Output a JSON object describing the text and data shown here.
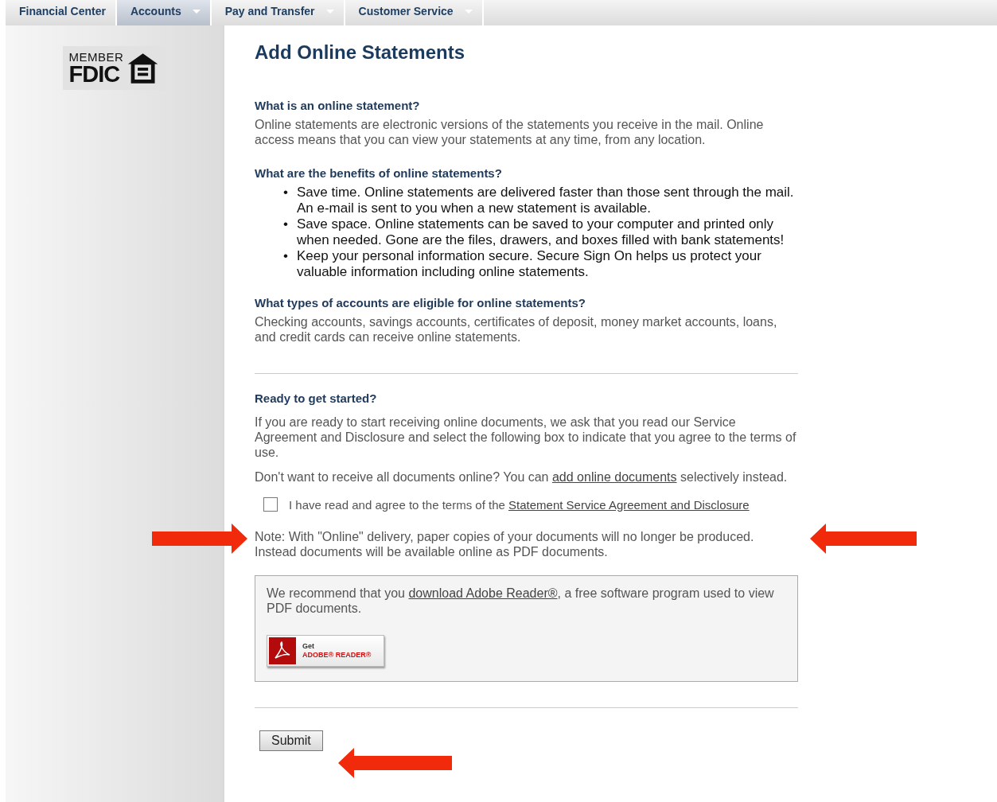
{
  "nav": {
    "tabs": [
      {
        "label": "Financial Center",
        "selected": false,
        "dropdown": false
      },
      {
        "label": "Accounts",
        "selected": true,
        "dropdown": true
      },
      {
        "label": "Pay and Transfer",
        "selected": false,
        "dropdown": true
      },
      {
        "label": "Customer Service",
        "selected": false,
        "dropdown": true
      }
    ]
  },
  "sidebar": {
    "logo": {
      "member": "MEMBER",
      "name": "FDIC"
    }
  },
  "title": "Add Online Statements",
  "sections": [
    {
      "heading": "What is an online statement?",
      "kind": "text",
      "text": "Online statements are electronic versions of the statements you receive in the mail. Online access means that you can view your statements at any time, from any location."
    },
    {
      "heading": "What are the benefits of online statements?",
      "kind": "bullets",
      "marker": "•",
      "items": [
        "Save time. Online statements are delivered faster than those sent through the mail. An e-mail is sent to you when a new statement is available.",
        "Save space. Online statements can be saved to your computer and printed only when needed. Gone are the files, drawers, and boxes filled with bank statements!",
        "Keep your personal information secure. Secure Sign On helps us protect your valuable information including online statements."
      ]
    },
    {
      "heading": "What types of accounts are eligible for online statements?",
      "kind": "text",
      "text": "Checking accounts, savings accounts, certificates of deposit, money market accounts, loans, and credit cards can receive online statements."
    }
  ],
  "ready": {
    "heading": "Ready to get started?",
    "intro": "If you are ready to start receiving online documents, we ask that you read our Service Agreement and Disclosure and select the following box to indicate that you agree to the terms of use.",
    "selective": {
      "before": "Don't want to receive all documents online? You can",
      "link": "add online documents",
      "after": "selectively instead."
    },
    "agree": {
      "checked": false,
      "label": "I have read and agree to the terms of the",
      "link": "Statement Service Agreement and Disclosure"
    },
    "note": "Note: With \"Online\" delivery, paper copies of your documents will no longer be produced. Instead documents will be available online as PDF documents."
  },
  "adobe": {
    "before": "We recommend that you",
    "link": "download Adobe Reader®",
    "after": ", a free software program used to view PDF documents.",
    "badge_get": "Get",
    "badge_name": "ADOBE® READER®"
  },
  "submit": "Submit"
}
